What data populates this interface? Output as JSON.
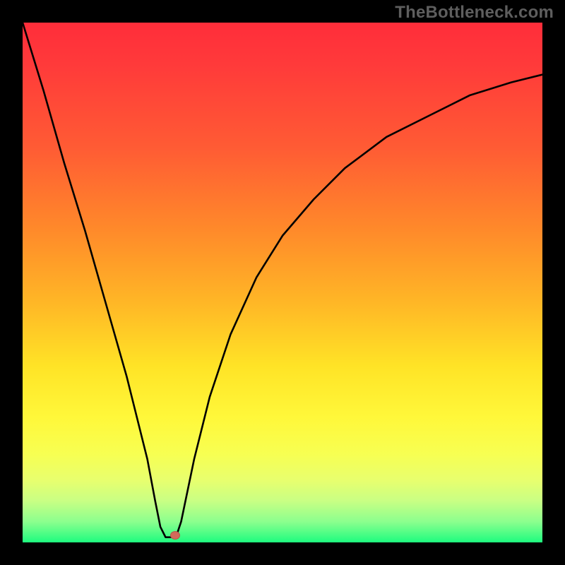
{
  "watermark": "TheBottleneck.com",
  "chart_data": {
    "type": "line",
    "title": "",
    "xlabel": "",
    "ylabel": "",
    "xlim": [
      0,
      100
    ],
    "ylim": [
      0,
      100
    ],
    "grid": false,
    "series": [
      {
        "name": "curve",
        "x": [
          0,
          4,
          8,
          12,
          16,
          20,
          22,
          24,
          25.5,
          26.5,
          27.5,
          29.5,
          30.5,
          33,
          36,
          40,
          45,
          50,
          56,
          62,
          70,
          78,
          86,
          94,
          100
        ],
        "y": [
          100,
          87,
          73,
          60,
          46,
          32,
          24,
          16,
          8,
          3,
          1,
          1,
          4,
          16,
          28,
          40,
          51,
          59,
          66,
          72,
          78,
          82,
          86,
          88.5,
          90
        ]
      }
    ],
    "marker": {
      "x": 29.3,
      "y": 1.4
    },
    "background_gradient": {
      "top": "#ff2d3a",
      "mid": "#ffe326",
      "bottom": "#1efc7f"
    }
  }
}
